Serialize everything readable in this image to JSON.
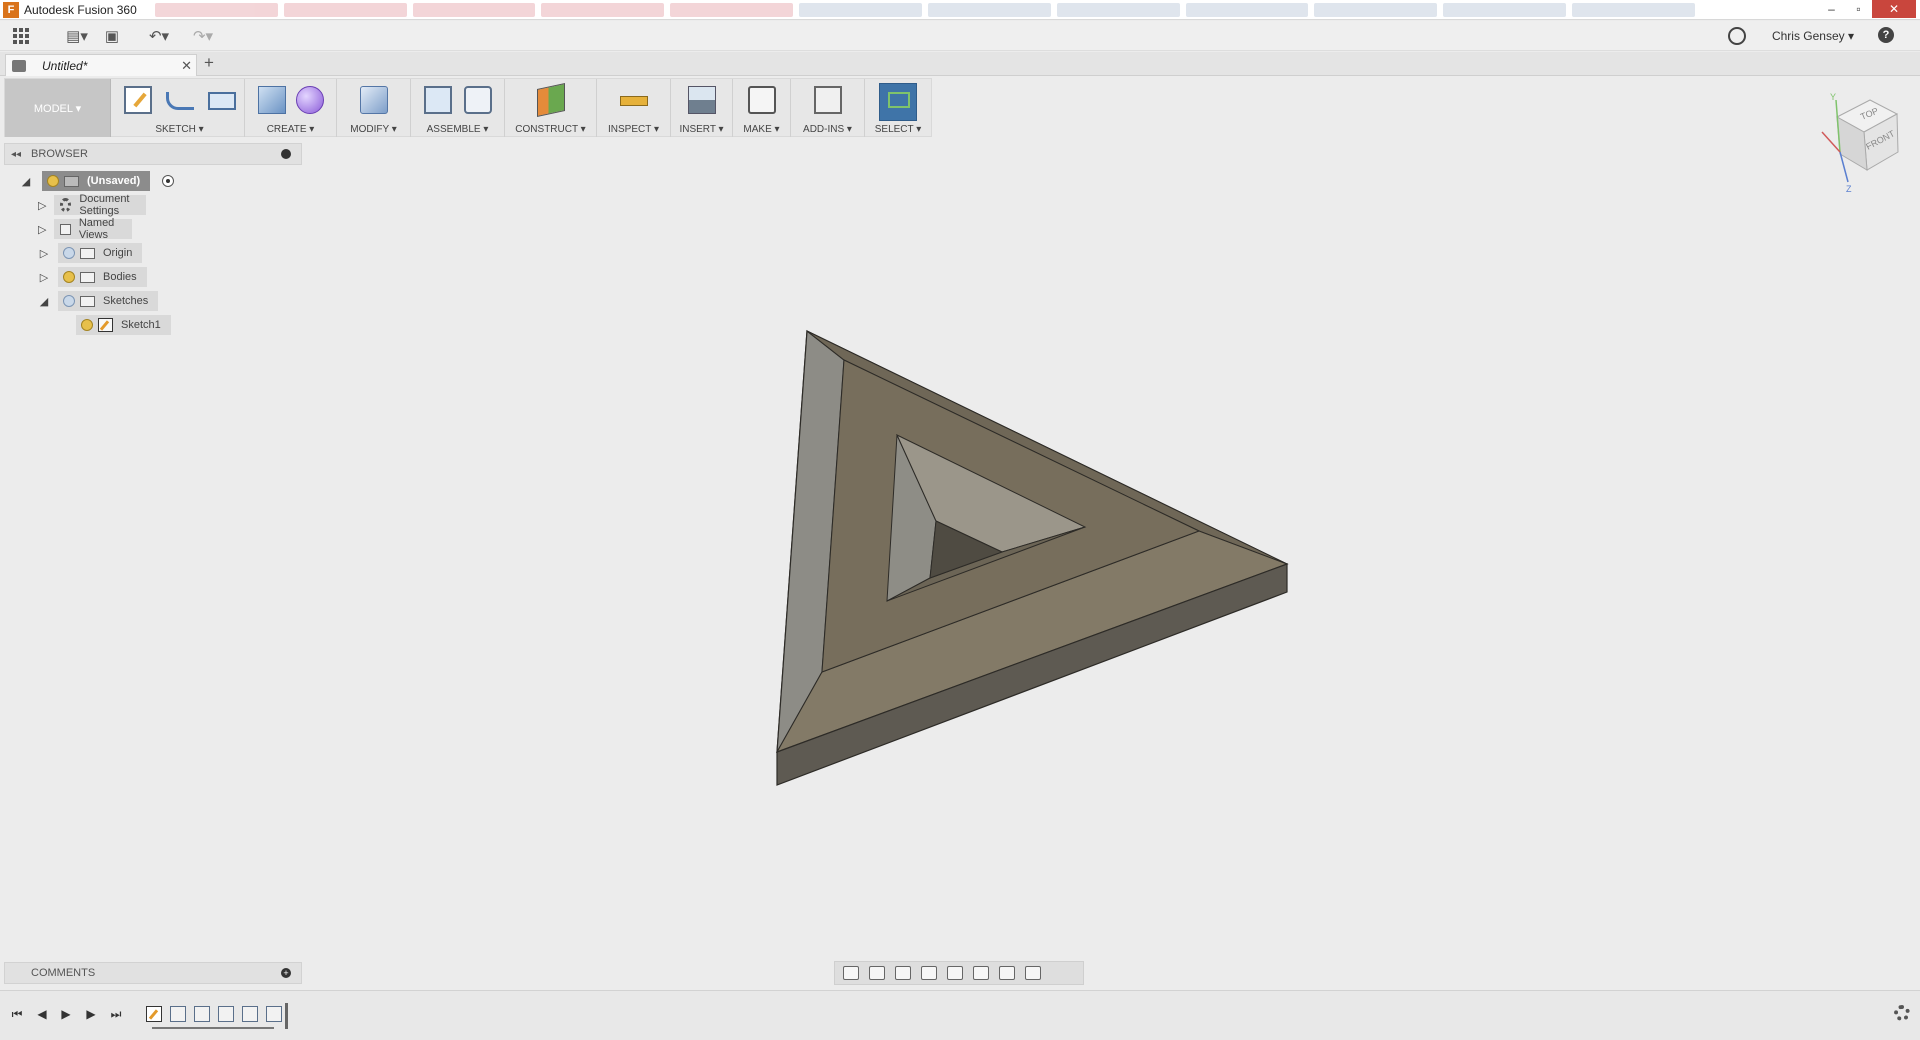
{
  "window": {
    "app_title": "Autodesk Fusion 360",
    "logo_letter": "F",
    "controls": {
      "minimize": "–",
      "maximize": "▫",
      "close": "✕"
    }
  },
  "quick_access": {
    "user_name": "Chris Gensey",
    "help_label": "?"
  },
  "document_tab": {
    "label": "Untitled*",
    "close": "✕",
    "new_tab": "+"
  },
  "toolbar": {
    "workspace": "MODEL ▾",
    "groups": {
      "sketch": "SKETCH ▾",
      "create": "CREATE ▾",
      "modify": "MODIFY ▾",
      "assemble": "ASSEMBLE ▾",
      "construct": "CONSTRUCT ▾",
      "inspect": "INSPECT ▾",
      "insert": "INSERT ▾",
      "make": "MAKE ▾",
      "addins": "ADD-INS ▾",
      "select": "SELECT ▾"
    }
  },
  "browser": {
    "title": "BROWSER",
    "collapse_glyph": "◂◂",
    "root": "(Unsaved)",
    "items": {
      "document_settings": "Document Settings",
      "named_views": "Named Views",
      "origin": "Origin",
      "bodies": "Bodies",
      "sketches": "Sketches",
      "sketch1": "Sketch1"
    },
    "expand_glyph": "▷",
    "collapse_item_glyph": "◢"
  },
  "viewcube": {
    "top": "TOP",
    "front": "FRONT",
    "axis_y": "Y",
    "axis_z": "Z"
  },
  "comments": {
    "title": "COMMENTS",
    "add": "+"
  },
  "timeline": {
    "first": "⏮",
    "prev": "◀",
    "play": "▶",
    "next": "▶",
    "last": "⏭"
  },
  "colors": {
    "select_active": "#3f74a8",
    "body_top": "#7a715f",
    "body_side": "#5e5a52",
    "body_bevel": "#8d8c86"
  }
}
